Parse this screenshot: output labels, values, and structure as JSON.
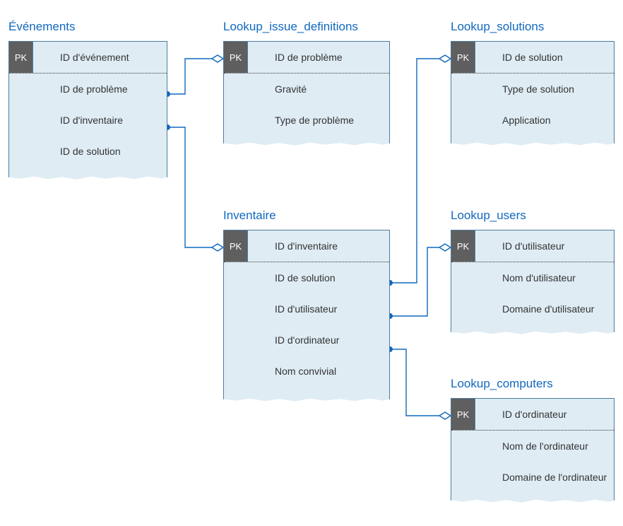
{
  "entities": {
    "evenements": {
      "title": "Événements",
      "pk": "PK",
      "pk_field": "ID d'événement",
      "fields": [
        "ID de problème",
        "ID d'inventaire",
        "ID de solution"
      ]
    },
    "issue_defs": {
      "title": "Lookup_issue_definitions",
      "pk": "PK",
      "pk_field": "ID de problème",
      "fields": [
        "Gravité",
        "Type de problème"
      ]
    },
    "solutions": {
      "title": "Lookup_solutions",
      "pk": "PK",
      "pk_field": "ID de solution",
      "fields": [
        "Type de solution",
        "Application"
      ]
    },
    "inventaire": {
      "title": "Inventaire",
      "pk": "PK",
      "pk_field": "ID d'inventaire",
      "fields": [
        "ID de solution",
        "ID d'utilisateur",
        "ID d'ordinateur",
        "Nom convivial"
      ]
    },
    "users": {
      "title": "Lookup_users",
      "pk": "PK",
      "pk_field": "ID d'utilisateur",
      "fields": [
        "Nom d'utilisateur",
        "Domaine d'utilisateur"
      ]
    },
    "computers": {
      "title": "Lookup_computers",
      "pk": "PK",
      "pk_field": "ID d'ordinateur",
      "fields": [
        "Nom de l'ordinateur",
        "Domaine de l'ordinateur"
      ]
    }
  }
}
